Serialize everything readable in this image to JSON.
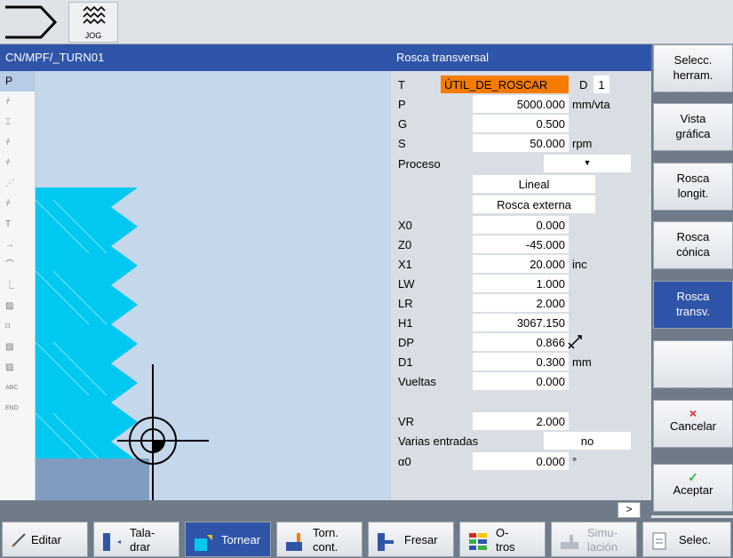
{
  "top": {
    "mode_label": "JOG"
  },
  "left": {
    "title": "CN/MPF/_TURN01",
    "strip_top_label": "P",
    "strip_t_label": "T",
    "strip_abc": "ABC",
    "strip_end": "END"
  },
  "form": {
    "title": "Rosca transversal",
    "tool": {
      "label": "T",
      "value": "ÚTIL_DE_ROSCAR",
      "d_label": "D",
      "d_value": "1"
    },
    "p": {
      "label": "P",
      "value": "5000.000",
      "unit": "mm/vta"
    },
    "g": {
      "label": "G",
      "value": "0.500"
    },
    "s": {
      "label": "S",
      "value": "50.000",
      "unit": "rpm"
    },
    "proceso": {
      "label": "Proceso",
      "mode": "Lineal",
      "type": "Rosca externa",
      "arrow": "▼"
    },
    "x0": {
      "label": "X0",
      "value": "0.000"
    },
    "z0": {
      "label": "Z0",
      "value": "-45.000"
    },
    "x1": {
      "label": "X1",
      "value": "20.000",
      "unit": "inc"
    },
    "lw": {
      "label": "LW",
      "value": "1.000"
    },
    "lr": {
      "label": "LR",
      "value": "2.000"
    },
    "h1": {
      "label": "H1",
      "value": "3067.150"
    },
    "dp": {
      "label": "DP",
      "value": "0.866"
    },
    "d1": {
      "label": "D1",
      "value": "0.300",
      "unit": "mm"
    },
    "vueltas": {
      "label": "Vueltas",
      "value": "0.000"
    },
    "vr": {
      "label": "VR",
      "value": "2.000"
    },
    "varias": {
      "label": "Varias entradas",
      "value": "no"
    },
    "a0": {
      "label": "α0",
      "value": "0.000",
      "unit": "°"
    },
    "scroll_arrow": ">"
  },
  "softkeys": {
    "selecc_herram": "Selecc.\nherram.",
    "vista_grafica": "Vista\ngráfica",
    "rosca_longit": "Rosca\nlongit.",
    "rosca_conica": "Rosca\ncónica",
    "rosca_transv": "Rosca\ntransv.",
    "cancelar": "Cancelar",
    "aceptar": "Aceptar",
    "cancel_mark": "×",
    "accept_mark": "✓"
  },
  "bottom": {
    "editar": "Editar",
    "taladrar": "Tala-\ndrar",
    "tornear": "Tornear",
    "torn_cont": "Torn.\ncont.",
    "fresar": "Fresar",
    "otros": "O-\ntros",
    "simulacion": "Simu-\nlación",
    "selec": "Selec."
  },
  "colors": {
    "header_blue": "#2f55a9",
    "tool_orange": "#f57c00",
    "thread_cyan": "#00c8f0",
    "graphic_bg": "#c5d7ea"
  }
}
